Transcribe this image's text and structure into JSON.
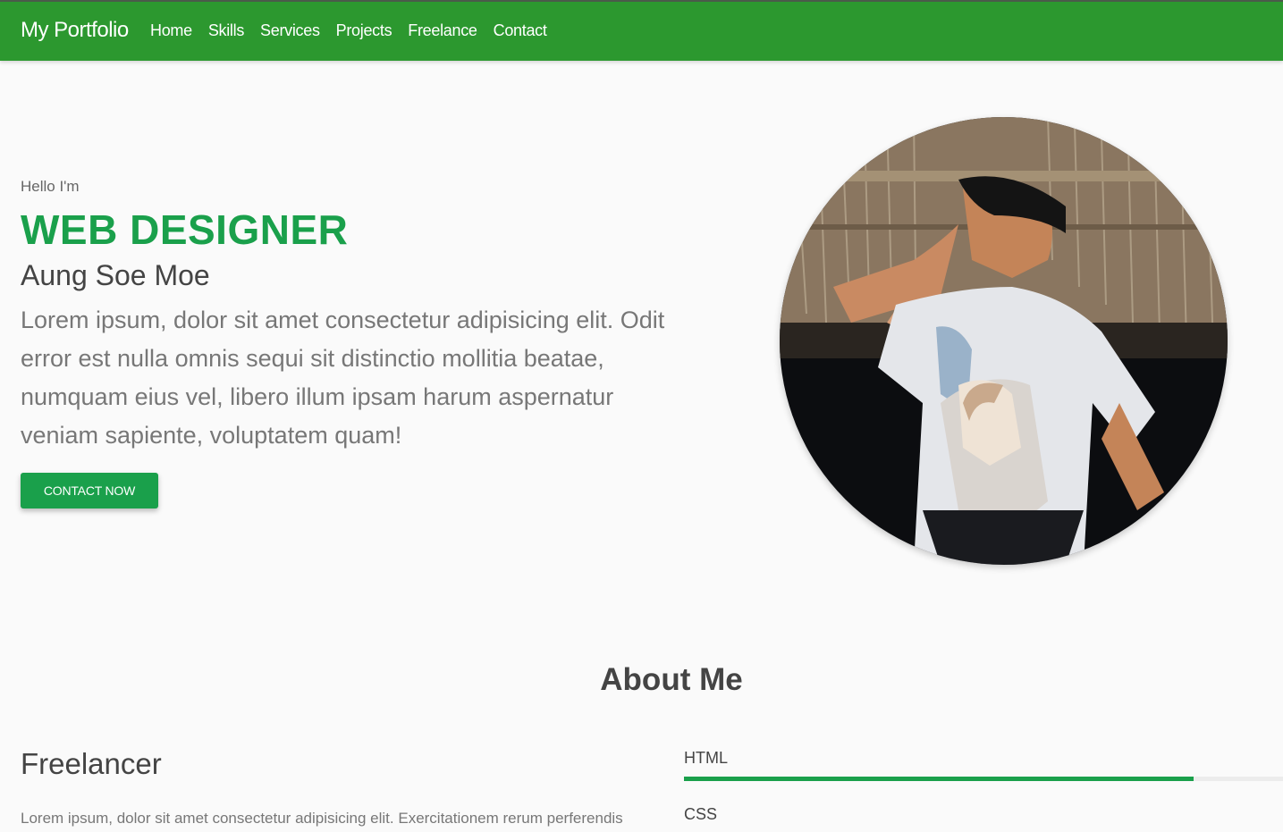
{
  "nav": {
    "brand": "My Portfolio",
    "links": [
      "Home",
      "Skills",
      "Services",
      "Projects",
      "Freelance",
      "Contact"
    ]
  },
  "hero": {
    "greeting": "Hello I'm",
    "headline": "WEB DESIGNER",
    "name": "Aung Soe Moe",
    "intro": "Lorem ipsum, dolor sit amet consectetur adipisicing elit. Odit error est nulla omnis sequi sit distinctio mollitia beatae, numquam eius vel, libero illum ipsam harum aspernatur veniam sapiente, voluptatem quam!",
    "cta_label": "CONTACT NOW"
  },
  "about": {
    "title": "About Me",
    "subtitle": "Freelancer",
    "text": "Lorem ipsum, dolor sit amet consectetur adipisicing elit. Exercitationem rerum perferendis",
    "skills": [
      {
        "label": "HTML",
        "level_percent": 85
      },
      {
        "label": "CSS"
      }
    ]
  },
  "colors": {
    "navbar": "#2c982f",
    "accent": "#1aa04b"
  }
}
